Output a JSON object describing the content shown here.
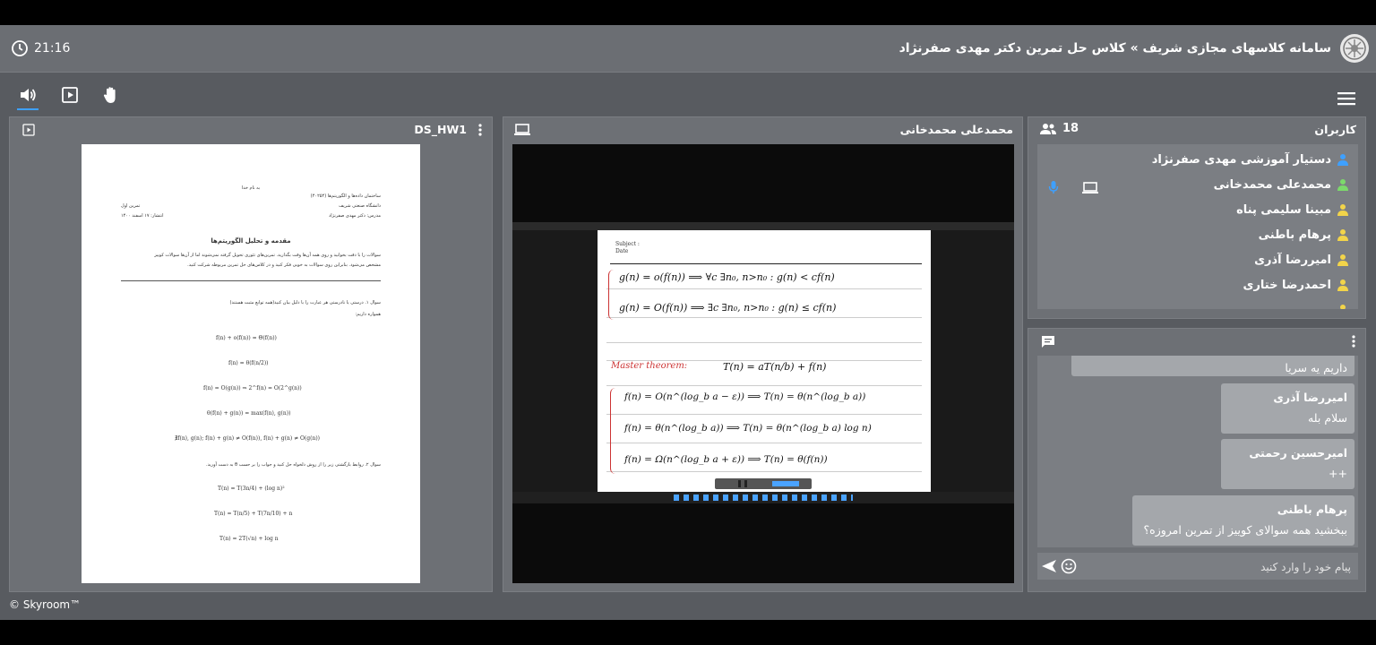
{
  "header": {
    "time": "21:16",
    "title": "سامانه کلاسهای مجازی شریف » کلاس حل تمرین دکتر مهدی صفرنژاد"
  },
  "toolbar": {
    "icons": [
      "speaker-icon",
      "presentation-icon",
      "raise-hand-icon",
      "menu-icon"
    ]
  },
  "document_panel": {
    "title": "DS_HW1",
    "doc": {
      "top_center": "به نام خدا",
      "course": "ساختمان داده‌ها و الگوریتم‌ها (۴۰۲۵۴)",
      "university": "دانشگاه صنعتی شریف",
      "instructor": "مدرس: دکتر مهدی صفرنژاد",
      "hw": "تمرین اول",
      "date": "انتشار: ۱۷ اسفند ۱۴۰۰",
      "heading": "مقدمه و تحلیل الگوریتم‌ها",
      "intro1": "سوالات را با دقت بخوانید و روی همه آن‌ها وقت بگذارید. تمرین‌های تئوری تحویل گرفته نمی‌شوند اما از آن‌ها سوالات کوییز",
      "intro2": "مشخص می‌شود. بنابراین روی سوالات به خوبی فکر کنید و در کلاس‌های حل تمرین مربوطه شرکت کنید.",
      "q1": "سوال ۱. درستی یا نادرستی هر عبارت را با دلیل بیان کنید(همه توابع مثبت هستند)",
      "q1b": "همواره داریم:",
      "f1": "f(n) + o(f(n)) = Θ(f(n))",
      "f2": "f(n) = θ(f(n/2))",
      "f3": "f(n) = O(g(n)) ⇒ 2^f(n) = O(2^g(n))",
      "f4": "θ(f(n) + g(n)) = max(f(n), g(n))",
      "f5": "∄f(n), g(n); f(n) + g(n) ≠ O(f(n)), f(n) + g(n) ≠ O(g(n))",
      "q2": "سوال ۲. روابط بازگشتی زیر را از روش دلخواه حل کنید و جواب را بر حسب θ به دست آورید.",
      "r1": "T(n) = T(3n/4) + (log n)²",
      "r2": "T(n) = T(n/5) + T(7n/10) + n",
      "r3": "T(n) = 2T(√n) + log n"
    }
  },
  "video_panel": {
    "title": "محمدعلی محمدخانی",
    "whiteboard": {
      "subject": "Subject :",
      "date": "Date",
      "line1": "g(n) = o(f(n))  ⟹  ∀c ∃n₀, n>n₀ : g(n) < cf(n)",
      "line2": "g(n) = O(f(n))  ⟹  ∃c ∃n₀, n>n₀ : g(n) ≤ cf(n)",
      "master_label": "Master theorem:",
      "master_formula": "T(n) = aT(n/b) + f(n)",
      "case1": "f(n) = O(n^(log_b a − ε))  ⟹  T(n) = θ(n^(log_b a))",
      "case2": "f(n) = θ(n^(log_b a))  ⟹  T(n) = θ(n^(log_b a) log n)",
      "case3": "f(n) = Ω(n^(log_b a + ε))  ⟹  T(n) = θ(f(n))"
    }
  },
  "users_panel": {
    "title": "کاربران",
    "count": "18",
    "users": [
      {
        "name": "دستیار آموزشی مهدی صفرنژاد",
        "color": "#3ea0ff"
      },
      {
        "name": "محمدعلی محمدخانی",
        "color": "#7cd96b"
      },
      {
        "name": "مبینا سلیمی پناه",
        "color": "#f2d44a"
      },
      {
        "name": "پرهام باطنی",
        "color": "#f2d44a"
      },
      {
        "name": "امیررضا آذری",
        "color": "#f2d44a"
      },
      {
        "name": "احمدرضا ختاری",
        "color": "#f2d44a"
      }
    ]
  },
  "chat_panel": {
    "messages": [
      {
        "name": "",
        "text": "داریم یه سریا"
      },
      {
        "name": "امیررضا آذری",
        "text": "سلام بله"
      },
      {
        "name": "امیرحسین رحمتی",
        "text": "++"
      },
      {
        "name": "پرهام باطنی",
        "text": "ببخشید همه سوالای کوییز از تمرین امروزه؟"
      }
    ],
    "input_placeholder": "پیام خود را وارد کنید"
  },
  "footer": {
    "brand": "© Skyroom™"
  },
  "colors": {
    "accent": "#3ea0ff",
    "presenter": "#7cd96b",
    "user": "#f2d44a",
    "panel": "#6d7075"
  }
}
